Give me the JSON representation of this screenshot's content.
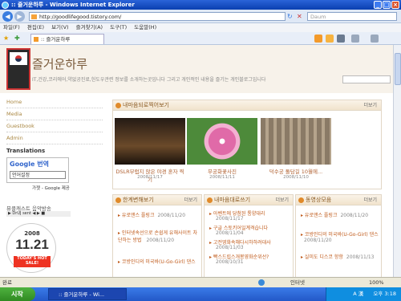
{
  "window": {
    "title": ":: 즐거운하루 - Windows Internet Explorer",
    "controls": [
      "minimize",
      "maximize",
      "close"
    ]
  },
  "address": {
    "url": "http://goodlifegood.tistory.com/",
    "search_placeholder": "Daum"
  },
  "menu": [
    "파일(F)",
    "편집(E)",
    "보기(V)",
    "즐겨찾기(A)",
    "도구(T)",
    "도움말(H)"
  ],
  "tab": {
    "label": ":: 즐거운하루"
  },
  "blog": {
    "title": "즐거운하루",
    "description": "IT,건강,코리에어,약없공진료,헌도우관련 정보를 소개하는곳입니다 그리고 개인적인 내용을 즐기는 개인블로그입니다",
    "logo_text": "미래한국, 통일한국 도약해야하는..."
  },
  "sidebar": {
    "links": [
      "Home",
      "Media",
      "Guestbook",
      "Admin"
    ],
    "translations_title": "Translations",
    "google_label": "Google 번역",
    "lang_select": "언어설정",
    "powered_by": "가젯 - Google 제공",
    "music_title": "뮤클캐스트 음악방송",
    "music_player": "▶ DrUJ sent ◀ ▶ ■",
    "badge": {
      "year": "2008",
      "date": "11.21",
      "caption": "TODAY'S HOT SALE!"
    }
  },
  "photos": {
    "title": "내마음되로찍어보기",
    "more": "더보기",
    "items": [
      {
        "caption": "DSLR부럽지 않은 야경 혼자 찍기",
        "date": "2008/11/17"
      },
      {
        "caption": "무궁화꽃사진",
        "date": "2008/11/11"
      },
      {
        "caption": "덕수궁 돌담길 10월에...",
        "date": "2008/11/10"
      }
    ]
  },
  "panels": [
    {
      "title": "한계변해보기",
      "more": "더보기",
      "items": [
        {
          "text": "유로앤스 플링크",
          "date": "2008/11/20"
        },
        {
          "text": "인터넷속선으로 손쉽게 유해사이트 차단하는 방법",
          "date": "2008/11/20"
        },
        {
          "text": "코방인디의 미국바(U-Go-Girl) 댄스",
          "date": ""
        }
      ]
    },
    {
      "title": "내마음대로쓰기",
      "more": "더보기",
      "items": [
        {
          "text": "아벤트에 당첨된 통양대리",
          "date": "2008/11/17"
        },
        {
          "text": "구글 스토키어일계격습니다",
          "date": "2008/11/04"
        },
        {
          "text": "고전영화속해다시하하려대사",
          "date": "2008/11/03"
        },
        {
          "text": "빡스드립스개봉영화순위선?",
          "date": "2008/10/31"
        }
      ]
    },
    {
      "title": "동영상모음",
      "more": "더보기",
      "items": [
        {
          "text": "유로앤스 플링크",
          "date": "2008/11/20"
        },
        {
          "text": "코방인디의 미국바(U-Go-Girl) 댄스",
          "date": "2008/11/20"
        },
        {
          "text": "실미도 디스코 항항",
          "date": "2008/11/13"
        }
      ]
    }
  ],
  "status": {
    "left": "완료",
    "zone": "인터넷",
    "zoom": "100%"
  },
  "taskbar": {
    "start": "시작",
    "task": ":: 즐거운하루 - Wi...",
    "clock": "오후 3:18",
    "ime": "A 漢"
  }
}
